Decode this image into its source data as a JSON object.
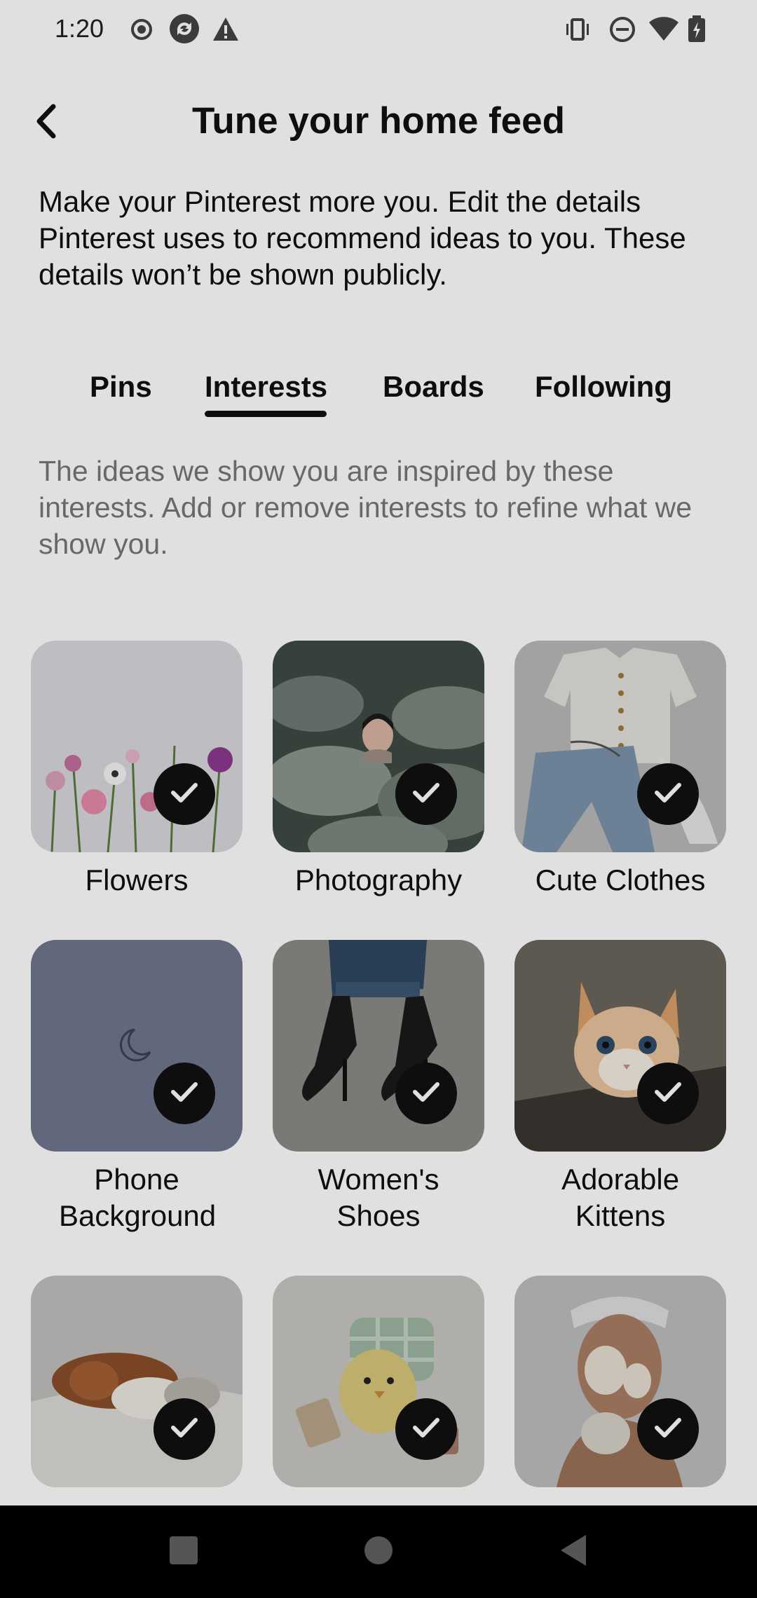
{
  "status_bar": {
    "time": "1:20",
    "left_icons": [
      "record-icon",
      "sync-icon",
      "warning-icon"
    ],
    "right_icons": [
      "vibrate-icon",
      "do-not-disturb-icon",
      "wifi-icon",
      "battery-charging-icon"
    ]
  },
  "header": {
    "back_icon": "back-arrow-icon",
    "title": "Tune your home feed"
  },
  "intro": "Make your Pinterest more you. Edit the details Pinterest uses to recommend ideas to you. These details won’t be shown publicly.",
  "tabs": [
    {
      "label": "Pins",
      "selected": false
    },
    {
      "label": "Interests",
      "selected": true
    },
    {
      "label": "Boards",
      "selected": false
    },
    {
      "label": "Following",
      "selected": false
    }
  ],
  "helper_text": "The ideas we show you are inspired by these interests. Add or remove interests to refine what we show you.",
  "interests": [
    {
      "label": "Flowers",
      "selected": true,
      "image": "flowers-image"
    },
    {
      "label": "Photography",
      "selected": true,
      "image": "photography-image"
    },
    {
      "label": "Cute Clothes",
      "selected": true,
      "image": "clothes-image"
    },
    {
      "label": "Phone Background",
      "selected": true,
      "image": "moon-wallpaper-image"
    },
    {
      "label": "Women's Shoes",
      "selected": true,
      "image": "shoes-image"
    },
    {
      "label": "Adorable Kittens",
      "selected": true,
      "image": "kitten-image"
    },
    {
      "label": "",
      "selected": true,
      "image": "sleeping-dogs-image"
    },
    {
      "label": "",
      "selected": true,
      "image": "cartoon-chick-image"
    },
    {
      "label": "",
      "selected": true,
      "image": "face-mask-image"
    }
  ],
  "nav_bar": {
    "icons": [
      "recents-square-icon",
      "home-circle-icon",
      "back-triangle-icon"
    ]
  },
  "colors": {
    "text_primary": "#111111",
    "text_secondary": "#777777",
    "check_badge": "#111111",
    "nav_bar": "#000000"
  }
}
